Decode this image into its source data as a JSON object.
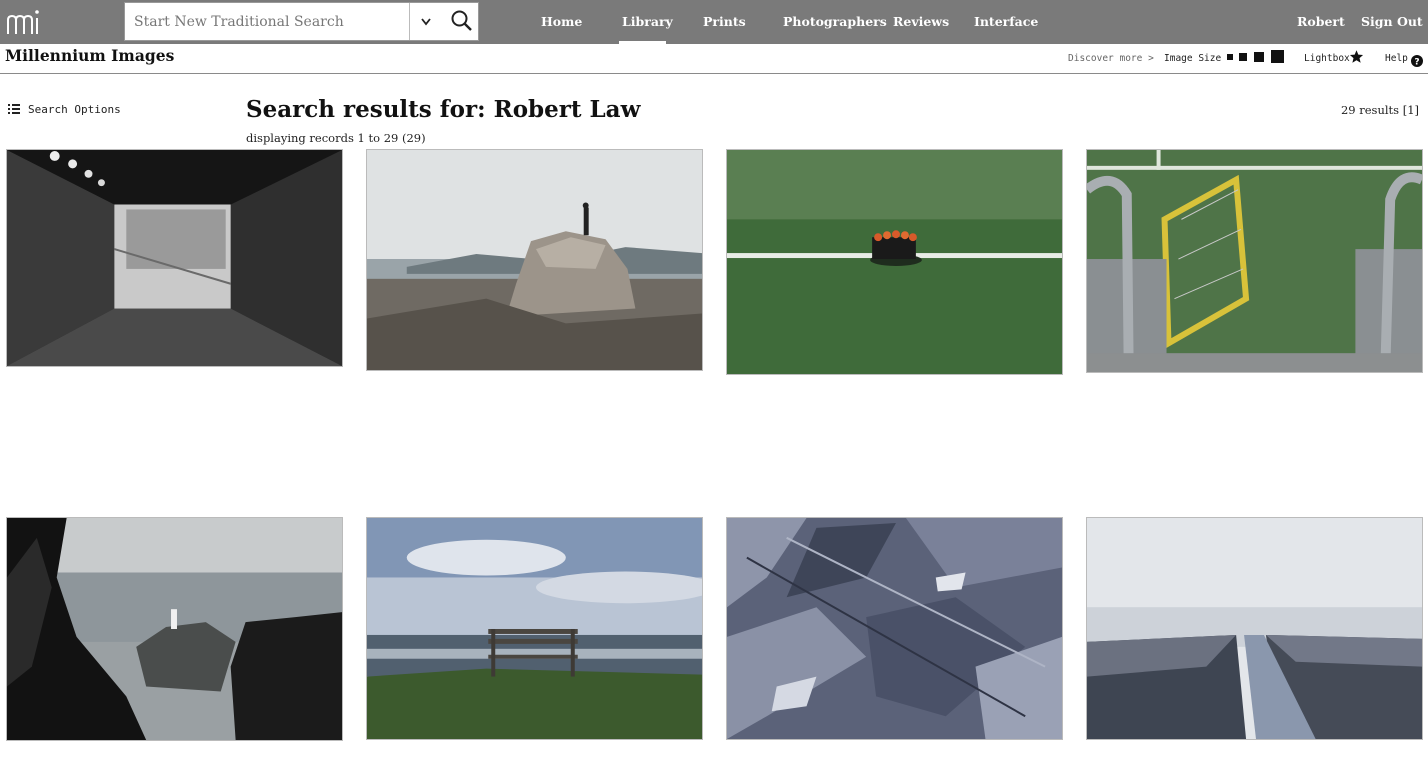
{
  "header": {
    "logo_text": "mi",
    "search": {
      "placeholder": "Start New Traditional Search",
      "value": ""
    },
    "nav": [
      {
        "label": "Home"
      },
      {
        "label": "Library",
        "active": true
      },
      {
        "label": "Prints"
      },
      {
        "label": "Photographers"
      },
      {
        "label": "Reviews"
      },
      {
        "label": "Interface"
      }
    ],
    "user": {
      "name": "Robert",
      "signout_label": "Sign Out"
    }
  },
  "subheader": {
    "site_title": "Millennium Images",
    "discover_label": "Discover more >",
    "image_size_label": "Image Size",
    "lightbox_label": "Lightbox",
    "help_label": "Help"
  },
  "results": {
    "search_options_label": "Search Options",
    "title": "Search results for: Robert Law",
    "displaying": "displaying records 1 to 29 (29)",
    "count": "29 results [1]"
  },
  "colors": {
    "topbar": "#7a7a7a",
    "nav_text": "#ffffff",
    "grass": "#3f6b3a",
    "sea": "#8e9aa6"
  },
  "thumbnails": [
    {
      "subject": "underpass-tunnel"
    },
    {
      "subject": "figure-on-rock"
    },
    {
      "subject": "bottle-crate-on-pitch"
    },
    {
      "subject": "yellow-gate-on-pitch"
    },
    {
      "subject": "lighthouse-cliffs"
    },
    {
      "subject": "bench-by-sea"
    },
    {
      "subject": "slate-shards"
    },
    {
      "subject": "misty-stream"
    }
  ]
}
